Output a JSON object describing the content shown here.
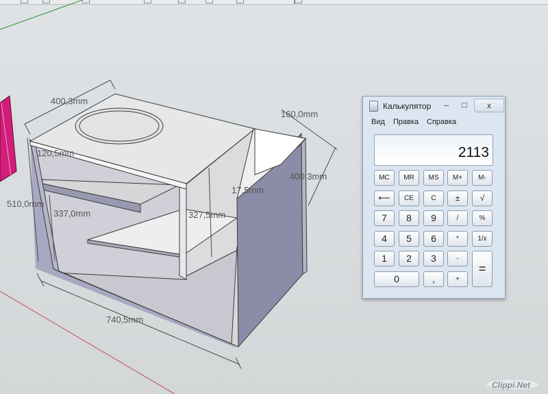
{
  "viewport": {
    "dimensions": {
      "top_width": "400,3mm",
      "top_depth": "160,0mm",
      "shelf_offset": "120,5mm",
      "panel_thickness": "17,5mm",
      "side_depth": "400,3mm",
      "height": "510,0mm",
      "inner_height": "337,0mm",
      "partition_height": "327,5mm",
      "length": "740,5mm"
    },
    "watermark": "Clippi.Net"
  },
  "calculator": {
    "title": "Калькулятор",
    "window_buttons": {
      "minimize": "–",
      "maximize": "□",
      "close": "x"
    },
    "menu": {
      "view": "Вид",
      "edit": "Правка",
      "help": "Справка"
    },
    "display": "2113",
    "keys": {
      "mc": "MC",
      "mr": "MR",
      "ms": "MS",
      "mplus": "M+",
      "mminus": "M-",
      "back": "⟵",
      "ce": "CE",
      "c": "C",
      "plusminus": "±",
      "sqrt": "√",
      "k7": "7",
      "k8": "8",
      "k9": "9",
      "div": "/",
      "pct": "%",
      "k4": "4",
      "k5": "5",
      "k6": "6",
      "mul": "*",
      "recip": "1/x",
      "k1": "1",
      "k2": "2",
      "k3": "3",
      "sub": "-",
      "eq": "=",
      "k0": "0",
      "comma": ",",
      "add": "+"
    }
  },
  "colors": {
    "top_panel": "#e6e7e8",
    "front_panel": "#8c8ca8",
    "side_panel": "#adacc6",
    "inner_panel": "#dcdcde",
    "shelf_top": "#d6d6d8",
    "magenta_object": "#d21e7a"
  }
}
